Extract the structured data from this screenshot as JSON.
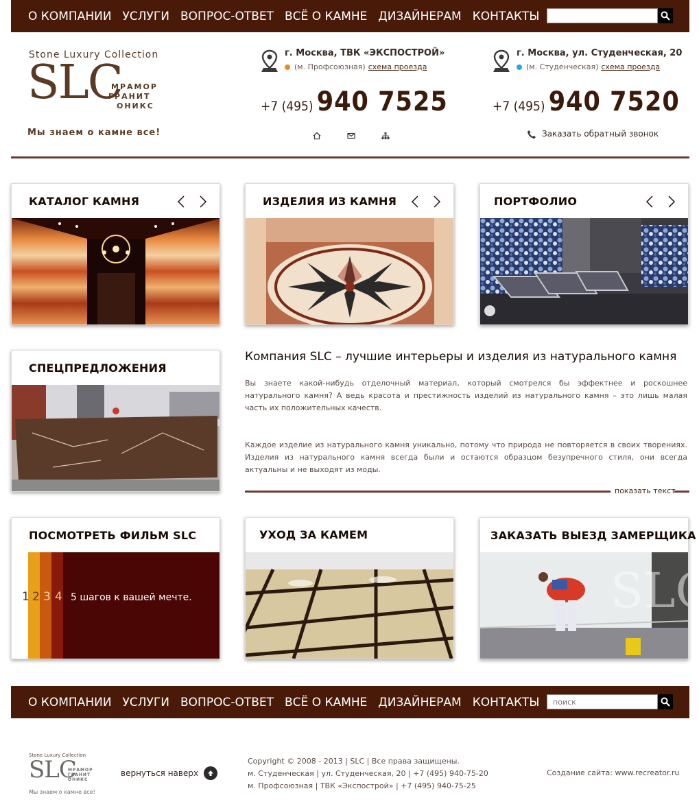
{
  "nav": {
    "items": [
      "О КОМПАНИИ",
      "УСЛУГИ",
      "ВОПРОС-ОТВЕТ",
      "ВСЁ О КАМНЕ",
      "ДИЗАЙНЕРАМ",
      "КОНТАКТЫ"
    ],
    "search_placeholder_top": "",
    "search_placeholder_bottom": "поиск"
  },
  "logo": {
    "top": "Stone Luxury Collection",
    "brand": "SLC",
    "sub1": "МРАМОР",
    "sub2": "ГРАНИТ",
    "sub3": "ОНИКС",
    "tagline": "Мы знаем о камне все!"
  },
  "contacts": [
    {
      "address": "г. Москва, ТВК «ЭКСПОСТРОЙ»",
      "metro": "(м. Профсоюзная)",
      "route": "схема проезда",
      "code": "+7 (495)",
      "number": "940 7525",
      "dot_color": "#f08a1c"
    },
    {
      "address": "г. Москва, ул. Студенческая, 20",
      "metro": "(м. Студенческая)",
      "route": "схема проезда",
      "code": "+7 (495)",
      "number": "940 7520",
      "dot_color": "#29a8e0"
    }
  ],
  "callback": "Заказать обратный звонок",
  "cards": {
    "catalog": "КАТАЛОГ КАМНЯ",
    "products": "ИЗДЕЛИЯ ИЗ КАМНЯ",
    "portfolio": "ПОРТФОЛИО",
    "special": "СПЕЦПРЕДЛОЖЕНИЯ",
    "film": "ПОСМОТРЕТЬ ФИЛЬМ SLC",
    "care": "УХОД ЗА КАМЕМ",
    "measure": "ЗАКАЗАТЬ ВЫЕЗД ЗАМЕРЩИКА"
  },
  "film_banner": {
    "digits": [
      "1",
      "2",
      "3",
      "4"
    ],
    "text": "5 шагов к вашей мечте."
  },
  "about": {
    "title": "Компания SLC – лучшие интерьеры и изделия из натурального камня",
    "p1": "Вы знаете какой-нибудь отделочный материал, который смотрелся бы эффектнее и роскошнее натурального камня? А ведь красота и престижность изделий из натурального камня – это лишь малая часть их положительных качеств.",
    "p2": "Каждое изделие из натурального камня уникально, потому что природа не повторяется в своих творениях. Изделия из натурального камня всегда были и остаются образцом безупречного стиля, они всегда актуальны и не выходят из моды.",
    "show_more": "показать текст"
  },
  "footer": {
    "to_top": "вернуться наверх",
    "copy1": "Copyright © 2008 - 2013 | SLC | Все права защищены.",
    "copy2": "м. Студенческая | ул. Студенческая, 20 | +7 (495) 940-75-20",
    "copy3": "м. Профсоюзная | ТВК «Экспострой» | +7 (495) 940-75-25",
    "creator": "Создание сайта: www.recreator.ru"
  }
}
